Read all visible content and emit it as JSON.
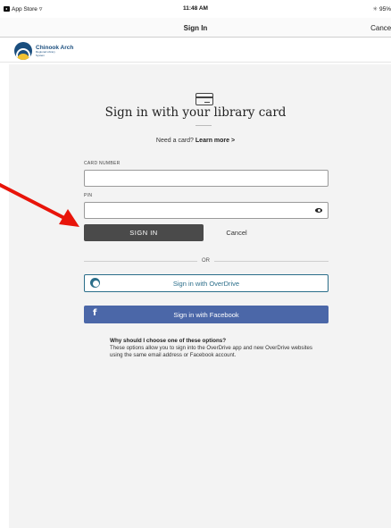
{
  "status_bar": {
    "back_app": "App Store",
    "wifi": "▿",
    "time": "11:48 AM",
    "bluetooth": "✳",
    "battery": "95%"
  },
  "nav": {
    "title": "Sign In",
    "cancel": "Cancel"
  },
  "brand": {
    "name": "Chinook Arch",
    "subtitle": "Regional Library System"
  },
  "form": {
    "heading": "Sign in with your library card",
    "need_card_prefix": "Need a card?",
    "learn_more": "Learn more >",
    "card_number_label": "CARD NUMBER",
    "card_number_value": "",
    "pin_label": "PIN",
    "pin_value": "",
    "sign_in": "SIGN IN",
    "cancel": "Cancel",
    "or": "OR",
    "overdrive": "Sign in with OverDrive",
    "facebook_glyph": "f",
    "facebook": "Sign in with Facebook",
    "why_title": "Why should I choose one of these options?",
    "why_body": "These options allow you to sign into the OverDrive app and new OverDrive websites using the same email address or Facebook account."
  },
  "colors": {
    "annotation_arrow": "#e8140a",
    "sign_in_button": "#4a4a4a",
    "facebook": "#4b67a8",
    "overdrive": "#2b6e8a",
    "brand": "#1a4e7e"
  }
}
